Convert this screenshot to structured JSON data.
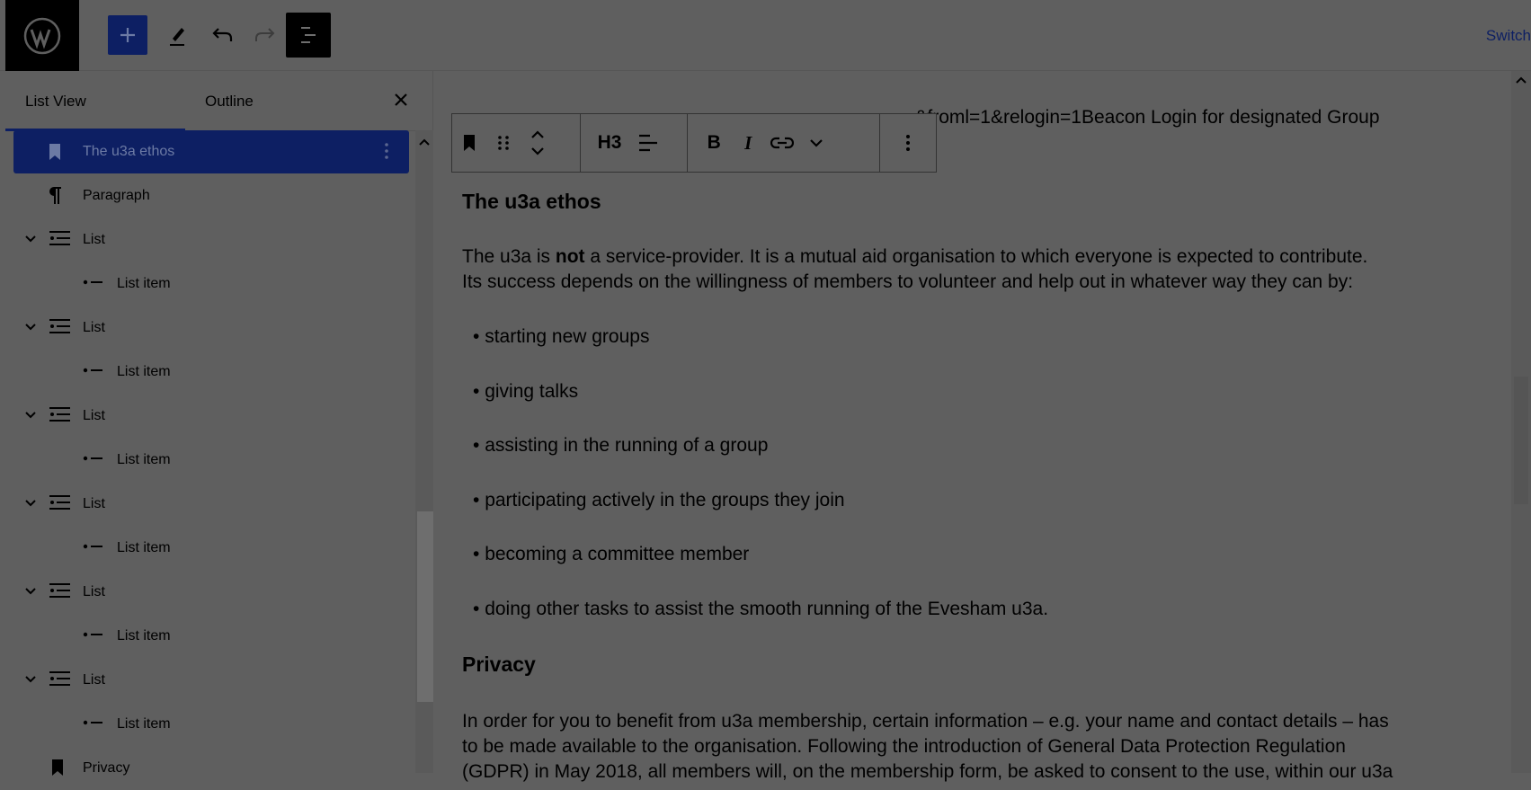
{
  "topbar": {
    "switch_label": "Switch"
  },
  "sidebar": {
    "tabs": [
      "List View",
      "Outline"
    ],
    "items": [
      {
        "label": "The u3a ethos",
        "icon": "bookmark-icon",
        "indent": 0
      },
      {
        "label": "Paragraph",
        "icon": "pilcrow-icon",
        "indent": 0
      },
      {
        "label": "List",
        "icon": "list-icon",
        "indent": 0
      },
      {
        "label": "List item",
        "icon": "list-item-icon",
        "indent": 1
      },
      {
        "label": "List",
        "icon": "list-icon",
        "indent": 0
      },
      {
        "label": "List item",
        "icon": "list-item-icon",
        "indent": 1
      },
      {
        "label": "List",
        "icon": "list-icon",
        "indent": 0
      },
      {
        "label": "List item",
        "icon": "list-item-icon",
        "indent": 1
      },
      {
        "label": "List",
        "icon": "list-icon",
        "indent": 0
      },
      {
        "label": "List item",
        "icon": "list-item-icon",
        "indent": 1
      },
      {
        "label": "List",
        "icon": "list-icon",
        "indent": 0
      },
      {
        "label": "List item",
        "icon": "list-item-icon",
        "indent": 1
      },
      {
        "label": "List",
        "icon": "list-icon",
        "indent": 0
      },
      {
        "label": "List item",
        "icon": "list-item-icon",
        "indent": 1
      },
      {
        "label": "Privacy",
        "icon": "bookmark-icon",
        "indent": 0
      }
    ]
  },
  "block_toolbar": {
    "heading_level": "H3",
    "bold": "B",
    "italic": "I"
  },
  "doc": {
    "top_link_tail": "&froml=1&relogin=1Beacon Login for designated Group",
    "heading1": "The u3a ethos",
    "para1_prefix": "The u3a is ",
    "para1_bold": "not",
    "para1_rest": " a service-provider. It is a mutual aid organisation to which everyone is expected to contribute.",
    "para1_line2": "Its success depends on the willingness of members to volunteer and help out in whatever way they can by:",
    "list": [
      "starting new groups",
      "giving talks",
      "assisting in the running of a group",
      "participating actively in the groups they join",
      "becoming a committee member",
      "doing other tasks to assist the smooth running of the Evesham u3a."
    ],
    "heading2": "Privacy",
    "para2_line1": "In order for you to benefit from u3a membership, certain information – e.g. your name and contact details – has",
    "para2_line2": "to be made available to the organisation. Following the introduction of General Data Protection Regulation",
    "para2_line3": "(GDPR) in May 2018, all members will, on the membership form, be asked to consent to the use, within our u3a"
  }
}
